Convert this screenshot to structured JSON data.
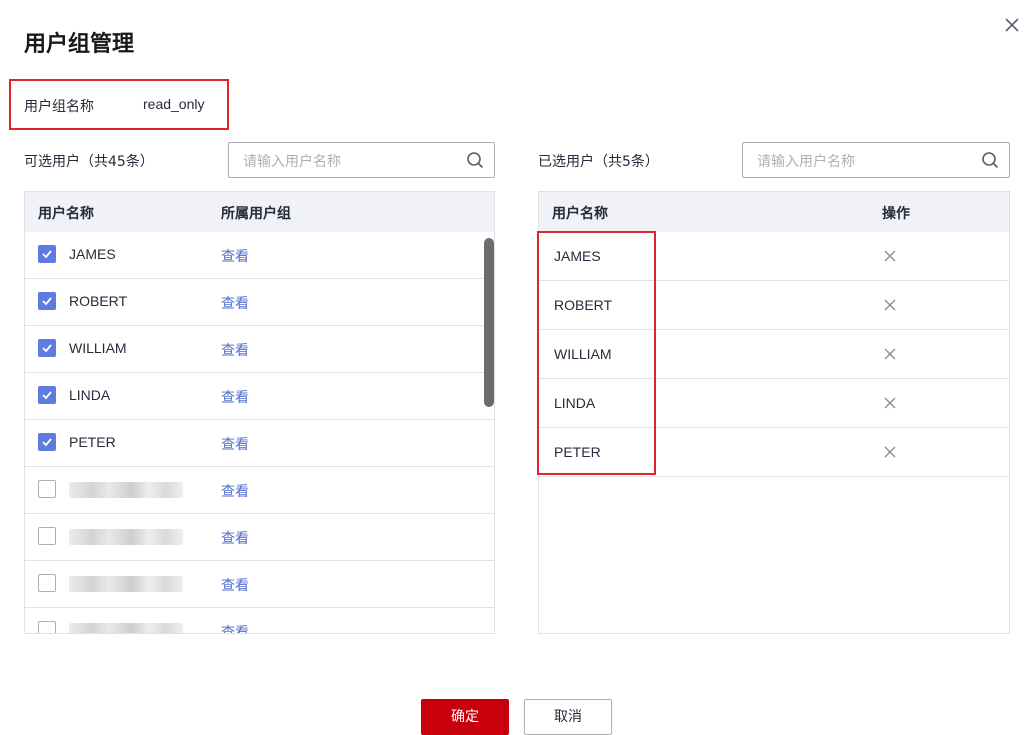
{
  "dialog": {
    "title": "用户组管理",
    "group_label": "用户组名称",
    "group_value": "read_only"
  },
  "available": {
    "count_label": "可选用户（共45条）",
    "search_placeholder": "请输入用户名称",
    "columns": [
      "用户名称",
      "所属用户组"
    ],
    "rows": [
      {
        "name": "JAMES",
        "checked": true,
        "link": "查看"
      },
      {
        "name": "ROBERT",
        "checked": true,
        "link": "查看"
      },
      {
        "name": "WILLIAM",
        "checked": true,
        "link": "查看"
      },
      {
        "name": "LINDA",
        "checked": true,
        "link": "查看"
      },
      {
        "name": "PETER",
        "checked": true,
        "link": "查看"
      },
      {
        "name": "",
        "checked": false,
        "link": "查看"
      },
      {
        "name": "",
        "checked": false,
        "link": "查看"
      },
      {
        "name": "",
        "checked": false,
        "link": "查看"
      },
      {
        "name": "",
        "checked": false,
        "link": "查看"
      }
    ]
  },
  "selected": {
    "count_label": "已选用户（共5条）",
    "search_placeholder": "请输入用户名称",
    "columns": [
      "用户名称",
      "操作"
    ],
    "rows": [
      {
        "name": "JAMES"
      },
      {
        "name": "ROBERT"
      },
      {
        "name": "WILLIAM"
      },
      {
        "name": "LINDA"
      },
      {
        "name": "PETER"
      }
    ]
  },
  "footer": {
    "ok_label": "确定",
    "cancel_label": "取消"
  },
  "colors": {
    "primary_button": "#c7000b",
    "checkbox_checked": "#5e7ce0",
    "link": "#526ecc",
    "highlight_border": "#e0242b"
  }
}
